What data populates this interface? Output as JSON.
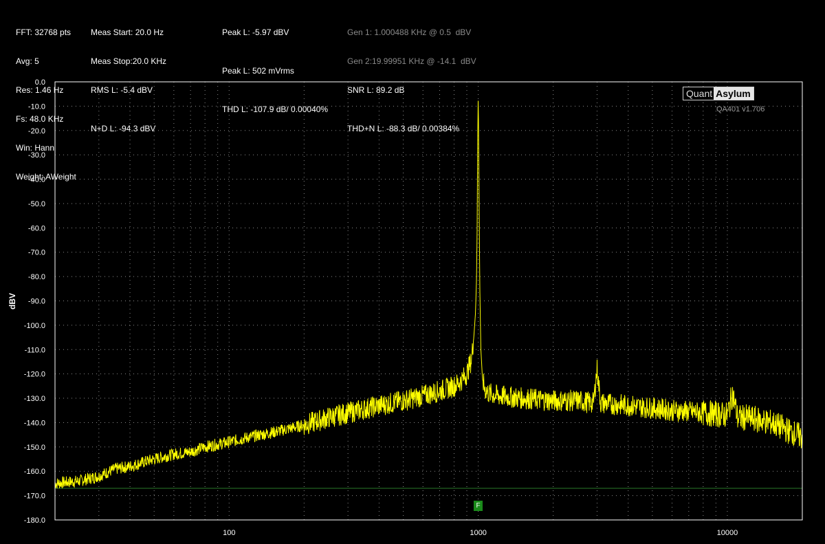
{
  "header": {
    "col1": [
      "FFT: 32768 pts",
      "Avg: 5",
      "Res: 1.46 Hz",
      "Fs: 48.0 KHz",
      "Win: Hann",
      "Weight: AWeight"
    ],
    "col2": [
      "Meas Start: 20.0 Hz",
      "Meas Stop:20.0 KHz",
      "RMS L: -5.4 dBV",
      "N+D L: -94.3 dBV"
    ],
    "col3": [
      "Peak L: -5.97 dBV",
      "Peak L: 502 mVrms",
      "THD L: -107.9 dB/ 0.00040%"
    ],
    "col4": [
      "Gen 1: 1.000488 KHz @ 0.5  dBV",
      "Gen 2:19.99951 KHz @ -14.1  dBV",
      "SNR L: 89.2 dB",
      "THD+N L: -88.3 dB/ 0.00384%"
    ]
  },
  "logo": {
    "left": "Quant",
    "right": "Asylum"
  },
  "version": "QA401 v1.706",
  "marker_label": "F",
  "colors": {
    "trace": "#ffff00",
    "background": "#000000",
    "grid": "#8c8c8c",
    "frame": "#ffffff",
    "baseline": "#2a7a2a",
    "marker": "#1a8a1a"
  },
  "chart_data": {
    "type": "line",
    "title": "",
    "xlabel": "",
    "ylabel": "dBV",
    "xscale": "log",
    "xlim": [
      20,
      20000
    ],
    "ylim": [
      -180,
      0
    ],
    "xticks": [
      100,
      1000,
      10000
    ],
    "yticks": [
      0,
      -10,
      -20,
      -30,
      -40,
      -50,
      -60,
      -70,
      -80,
      -90,
      -100,
      -110,
      -120,
      -130,
      -140,
      -150,
      -160,
      -170,
      -180
    ],
    "ytick_labels": [
      "0.0",
      "-10.0",
      "-20.0",
      "-30.0",
      "-40.0",
      "-50.0",
      "-60.0",
      "-70.0",
      "-80.0",
      "-90.0",
      "-100.0",
      "-110.0",
      "-120.0",
      "-130.0",
      "-140.0",
      "-150.0",
      "-160.0",
      "-170.0",
      "-180.0"
    ],
    "grid": true,
    "baseline_dbv": -167,
    "series": [
      {
        "x": [
          20,
          25,
          30,
          35,
          40,
          50,
          60,
          70,
          80,
          100,
          120,
          150,
          200,
          250,
          300,
          400,
          500,
          600,
          700,
          800,
          850,
          900,
          940,
          960,
          975,
          985,
          990,
          995,
          998,
          1000,
          1002,
          1005,
          1010,
          1015,
          1025,
          1040,
          1060,
          1100,
          1200,
          1500,
          2000,
          2500,
          2900,
          3000,
          3100,
          4000,
          5000,
          6000,
          8000,
          10000,
          10500,
          11000,
          12000,
          15000,
          20000
        ],
        "y": [
          -165,
          -164,
          -162,
          -159,
          -158,
          -155,
          -153,
          -152,
          -150,
          -148,
          -146,
          -144,
          -141,
          -138,
          -136,
          -133,
          -131,
          -129,
          -127,
          -125,
          -123,
          -120,
          -114,
          -105,
          -95,
          -80,
          -60,
          -25,
          -12,
          -6,
          -12,
          -30,
          -60,
          -85,
          -110,
          -122,
          -126,
          -128,
          -129,
          -130,
          -131,
          -131,
          -132,
          -118,
          -132,
          -133,
          -134,
          -135,
          -136,
          -137,
          -128,
          -138,
          -138,
          -140,
          -146
        ]
      }
    ]
  }
}
